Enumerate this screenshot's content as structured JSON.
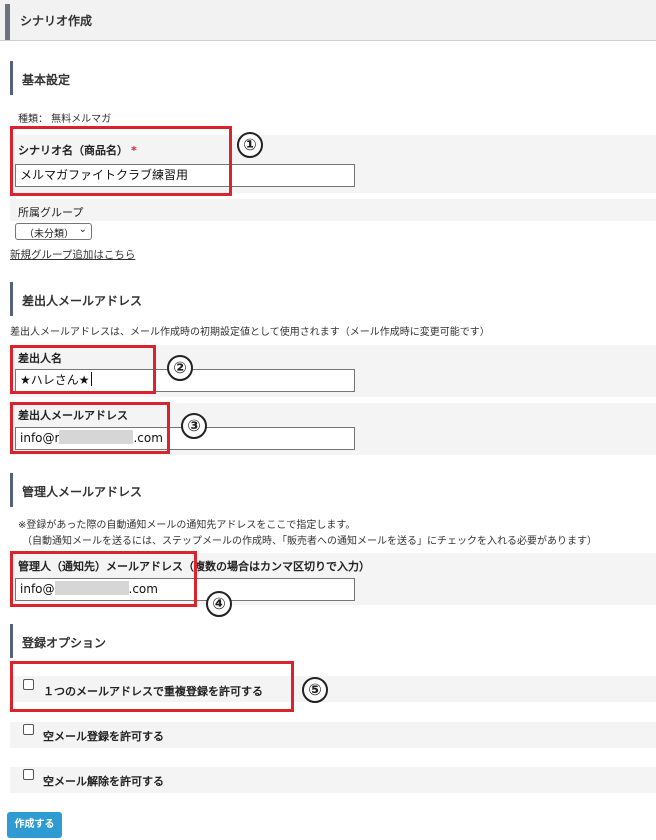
{
  "header": {
    "title": "シナリオ作成"
  },
  "basic": {
    "heading": "基本設定",
    "type_text": "種類： 無料メルマガ",
    "scenario_name_label": "シナリオ名（商品名）",
    "required_mark": "*",
    "scenario_name_value": "メルマガファイトクラブ練習用",
    "group_label": "所属グループ",
    "group_selected": "（未分類）",
    "new_group_link": "新規グループ追加はこちら"
  },
  "sender": {
    "heading": "差出人メールアドレス",
    "note": "差出人メールアドレスは、メール作成時の初期設定値として使用されます（メール作成時に変更可能です）",
    "name_label": "差出人名",
    "name_value": "★ハレさん★",
    "email_label": "差出人メールアドレス",
    "email_prefix": "info@r",
    "email_suffix": ".com"
  },
  "admin": {
    "heading": "管理人メールアドレス",
    "note1": "※登録があった際の自動通知メールの通知先アドレスをここで指定します。",
    "note2": "（自動通知メールを送るには、ステップメールの作成時、「販売者への通知メールを送る」にチェックを入れる必要があります）",
    "email_label": "管理人（通知先）メールアドレス",
    "email_hint": "（複数の場合はカンマ区切りで入力）",
    "email_prefix": "info@",
    "email_suffix": ".com"
  },
  "options": {
    "heading": "登録オプション",
    "items": [
      {
        "label": "１つのメールアドレスで重複登録を許可する",
        "checked": false
      },
      {
        "label": "空メール登録を許可する",
        "checked": false
      },
      {
        "label": "空メール解除を許可する",
        "checked": false
      }
    ]
  },
  "markers": [
    "①",
    "②",
    "③",
    "④",
    "⑤"
  ],
  "create_button": "作成する",
  "colors": {
    "annotation_red": "#d9232d",
    "button_blue": "#2e9bd2",
    "required_red": "#d9232d"
  }
}
